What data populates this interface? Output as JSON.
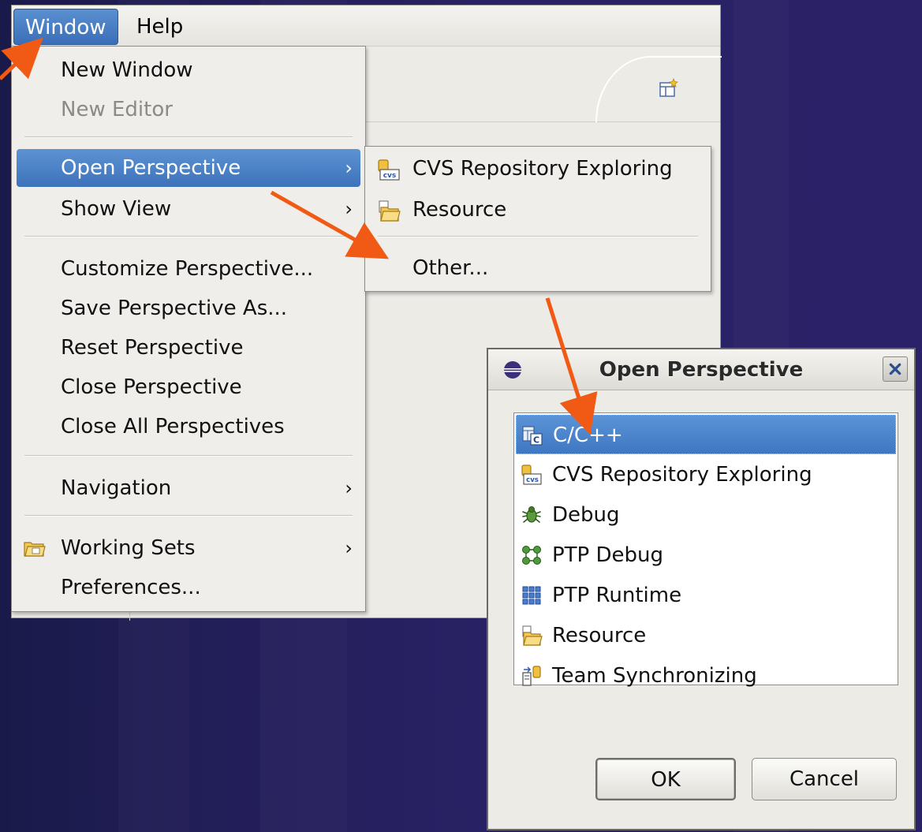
{
  "menubar": {
    "window_label": "Window",
    "help_label": "Help"
  },
  "window_menu": {
    "new_window": "New Window",
    "new_editor": "New Editor",
    "open_perspective": "Open Perspective",
    "show_view": "Show View",
    "customize_perspective": "Customize Perspective...",
    "save_perspective_as": "Save Perspective As...",
    "reset_perspective": "Reset Perspective",
    "close_perspective": "Close Perspective",
    "close_all_perspectives": "Close All Perspectives",
    "navigation": "Navigation",
    "working_sets": "Working Sets",
    "preferences": "Preferences...",
    "submenu_arrow": "›"
  },
  "open_perspective_submenu": {
    "cvs": "CVS Repository Exploring",
    "resource": "Resource",
    "other": "Other..."
  },
  "dialog": {
    "title": "Open Perspective",
    "items": [
      "C/C++",
      "CVS Repository Exploring",
      "Debug",
      "PTP Debug",
      "PTP Runtime",
      "Resource",
      "Team Synchronizing"
    ],
    "selected_item": "C/C++",
    "ok_label": "OK",
    "cancel_label": "Cancel"
  },
  "colors": {
    "selection": "#3f78c2",
    "annotation_arrow": "#f05a14",
    "background": "#262060"
  },
  "icons": {
    "cvs": "cvs-repository-icon",
    "resource": "resource-folder-icon",
    "cpp": "cpp-perspective-icon",
    "debug": "debug-bug-icon",
    "ptp_debug": "ptp-debug-icon",
    "ptp_runtime": "ptp-runtime-icon",
    "team": "team-sync-icon",
    "working_sets": "working-sets-icon",
    "eclipse": "eclipse-icon",
    "close": "close-icon",
    "open_perspective": "open-perspective-icon"
  }
}
